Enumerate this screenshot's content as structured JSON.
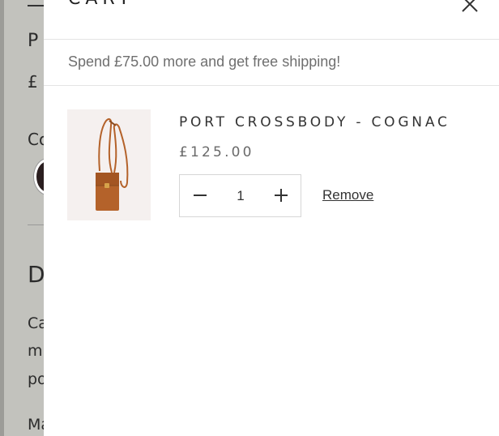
{
  "background_page": {
    "title_fragment": "P",
    "price_fragment": "£",
    "color_fragment": "Co",
    "heading_fragment": "D",
    "text_fragments": [
      "Ca",
      "mi",
      "po",
      "Ma"
    ]
  },
  "cart": {
    "title": "CART",
    "shipping_message": "Spend £75.00 more and get free shipping!",
    "items": [
      {
        "name": "PORT CROSSBODY - COGNAC",
        "price": "£125.00",
        "quantity": "1",
        "remove_label": "Remove"
      }
    ]
  },
  "colors": {
    "bag": "#b4622a",
    "image_bg": "#f5f0ef"
  }
}
